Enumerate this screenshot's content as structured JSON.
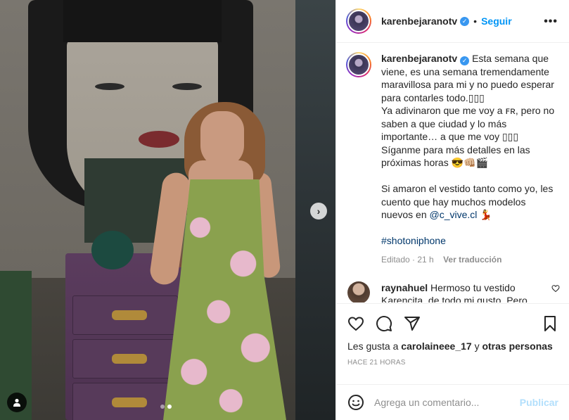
{
  "post": {
    "username": "karenbejaranotv",
    "separator": "•",
    "follow_label": "Seguir",
    "more_icon": "•••"
  },
  "caption": {
    "username": "karenbejaranotv",
    "text_1": "Esta semana que viene, es una semana tremendamente maravillosa para mi y no puedo esperar para contarles todo.▯▯▯",
    "text_2": "Ya adivinaron que me voy a ꜰʀ, pero no saben a que ciudad y lo más importante… a que me voy ▯▯▯",
    "text_3": "Síganme para más detalles en las próximas horas 😎👊🏼🎬",
    "text_4": "Si amaron el vestido tanto como yo, les cuento que hay muchos modelos nuevos en",
    "mention": "@c_vive.cl",
    "emoji_after_mention": "💃",
    "hashtag": "#shotoniphone",
    "edited_label": "Editado · 21 h",
    "translate_label": "Ver traducción"
  },
  "comment": {
    "username": "raynahuel",
    "text": "Hermoso tu vestido Karencita, de todo mi gusto. Pero"
  },
  "likes": {
    "prefix": "Les gusta a",
    "user": "carolaineee_17",
    "middle": "y",
    "others": "otras personas"
  },
  "timestamp": "HACE 21 HORAS",
  "add_comment": {
    "placeholder": "Agrega un comentario...",
    "publish_label": "Publicar"
  },
  "carousel": {
    "next_glyph": "›",
    "slides": 2,
    "active_slide": 2
  },
  "colors": {
    "accent": "#0095f6",
    "publish_disabled": "#b2dffc",
    "verified": "#3897f0"
  }
}
